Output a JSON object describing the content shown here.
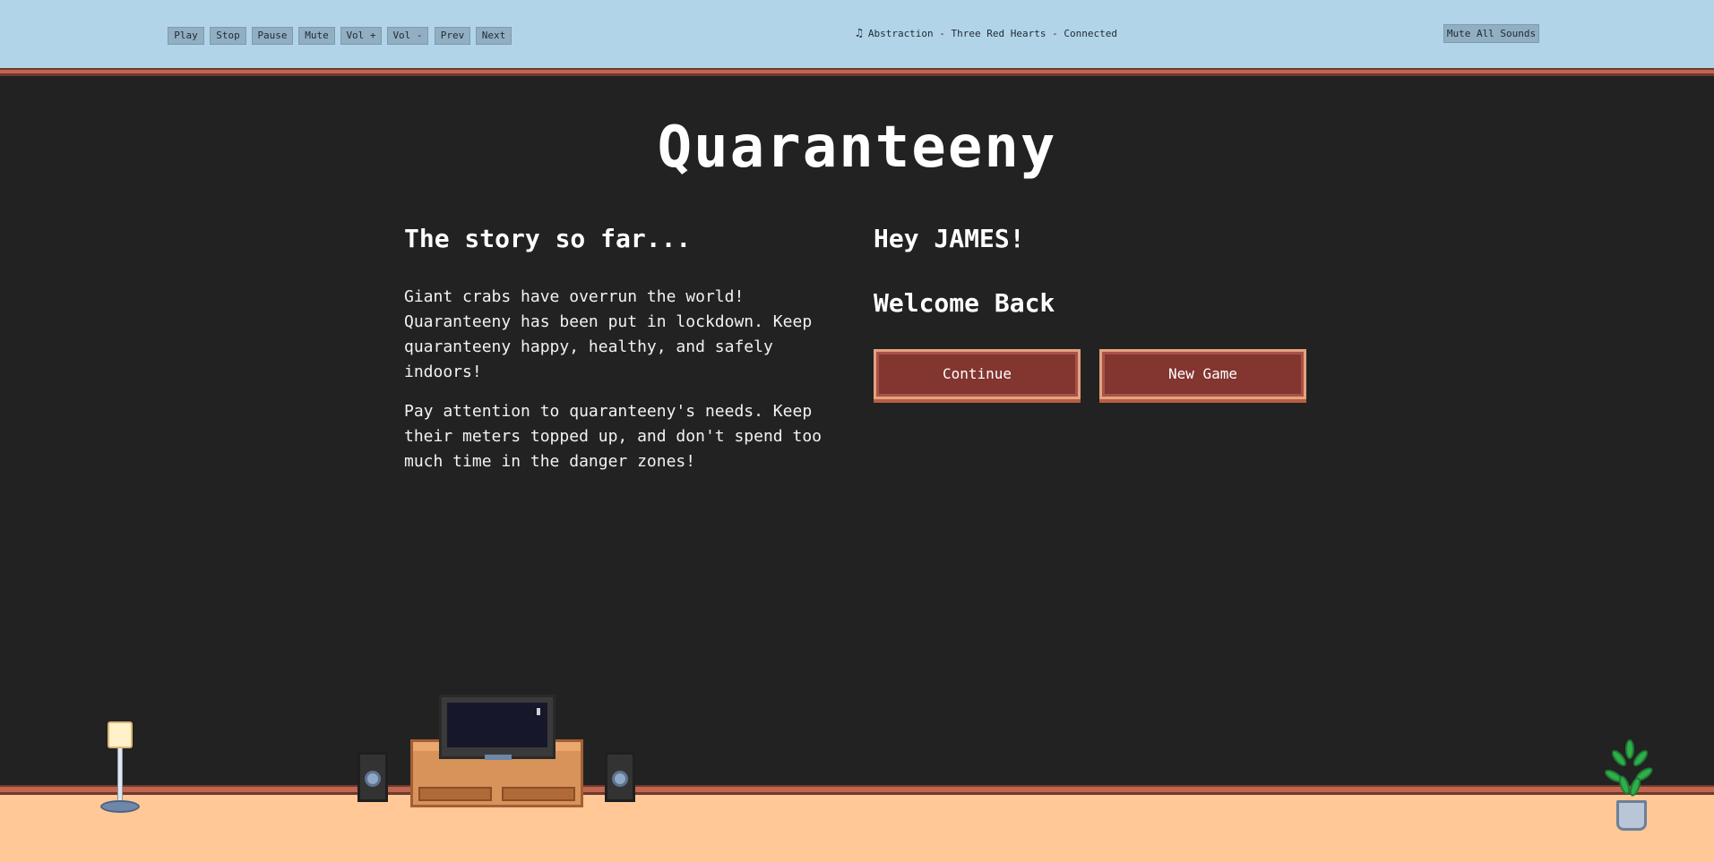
{
  "music_bar": {
    "controls": [
      "Play",
      "Stop",
      "Pause",
      "Mute",
      "Vol +",
      "Vol -",
      "Prev",
      "Next"
    ],
    "now_playing": "Abstraction - Three Red Hearts - Connected",
    "mute_all_label": "Mute All Sounds",
    "note_icon": "music-note-icon"
  },
  "game": {
    "title": "Quaranteeny"
  },
  "story": {
    "heading": "The story so far...",
    "paragraph_1": "Giant crabs have overrun the world! Quaranteeny has been put in lockdown. Keep quaranteeny happy, healthy, and safely indoors!",
    "paragraph_2": "Pay attention to quaranteeny's needs. Keep their meters topped up, and don't spend too much time in the danger zones!"
  },
  "welcome": {
    "greeting": "Hey JAMES!",
    "subheading": "Welcome Back",
    "continue_label": "Continue",
    "new_game_label": "New Game"
  },
  "colors": {
    "background": "#222222",
    "topbar": "#b2d4e8",
    "button_fill": "#833530",
    "button_border": "#e3a27d",
    "rail": "#c0654f",
    "floor": "#ffc896"
  }
}
